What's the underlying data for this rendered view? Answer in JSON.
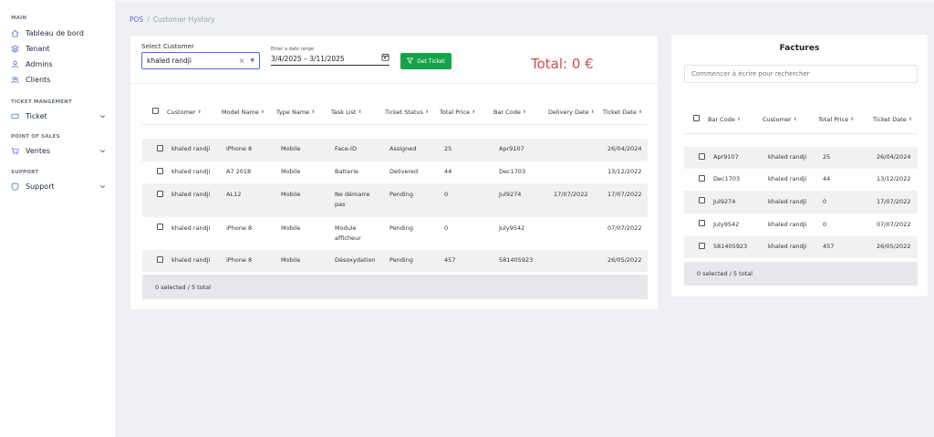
{
  "sidebar": {
    "sections": [
      {
        "title": "MAIN"
      },
      {
        "title": "TICKET MANGEMENT"
      },
      {
        "title": "POINT OF SALES"
      },
      {
        "title": "SUPPORT"
      }
    ],
    "items": [
      {
        "label": "Tableau de bord",
        "icon": "home-icon"
      },
      {
        "label": "Tenant",
        "icon": "layers-icon"
      },
      {
        "label": "Admins",
        "icon": "user-icon"
      },
      {
        "label": "Clients",
        "icon": "users-icon"
      },
      {
        "label": "Ticket",
        "icon": "ticket-icon"
      },
      {
        "label": "Ventes",
        "icon": "cart-icon"
      },
      {
        "label": "Support",
        "icon": "shield-icon"
      }
    ]
  },
  "breadcrumb": {
    "root": "POS",
    "sep": "/",
    "current": "Customer Hystory"
  },
  "filters": {
    "select_label": "Select Customer",
    "customer_value": "khaled randji",
    "date_label": "Enter a date range",
    "date_value": "3/4/2025 – 3/11/2025",
    "get_button": "Get Ticket",
    "total": "Total: 0 €"
  },
  "tickets": {
    "headers": [
      "Customer",
      "Model Name",
      "Type Name",
      "Task List",
      "Ticket Status",
      "Total Price",
      "Bar Code",
      "Delivery Date",
      "Ticket Date"
    ],
    "rows": [
      {
        "customer": "khaled randji",
        "model": "iPhone 8",
        "type": "Mobile",
        "task": "Face-ID",
        "status": "Assigned",
        "price": "25",
        "barcode": "Apr9107",
        "delivery": "",
        "date": "26/04/2024"
      },
      {
        "customer": "khaled randji",
        "model": "A7 2018",
        "type": "Mobile",
        "task": "Batterie",
        "status": "Delivered",
        "price": "44",
        "barcode": "Dec1703",
        "delivery": "",
        "date": "13/12/2022"
      },
      {
        "customer": "khaled randji",
        "model": "AL12",
        "type": "Mobile",
        "task": "Ne démarre pas",
        "status": "Pending",
        "price": "0",
        "barcode": "Jul9274",
        "delivery": "17/07/2022",
        "date": "17/07/2022"
      },
      {
        "customer": "khaled randji",
        "model": "iPhone 8",
        "type": "Mobile",
        "task": "Module afficheur",
        "status": "Pending",
        "price": "0",
        "barcode": "July9542",
        "delivery": "",
        "date": "07/07/2022"
      },
      {
        "customer": "khaled randji",
        "model": "iPhone 8",
        "type": "Mobile",
        "task": "Désoxydation",
        "status": "Pending",
        "price": "457",
        "barcode": "581405923",
        "delivery": "",
        "date": "26/05/2022"
      }
    ],
    "footer": "0 selected / 5 total"
  },
  "factures": {
    "title": "Factures",
    "search_placeholder": "Commencer à écrire pour rechercher",
    "headers": [
      "Bar Code",
      "Customer",
      "Total Price",
      "Ticket Date"
    ],
    "rows": [
      {
        "barcode": "Apr9107",
        "customer": "khaled randji",
        "price": "25",
        "date": "26/04/2024"
      },
      {
        "barcode": "Dec1703",
        "customer": "khaled randji",
        "price": "44",
        "date": "13/12/2022"
      },
      {
        "barcode": "Jul9274",
        "customer": "khaled randji",
        "price": "0",
        "date": "17/07/2022"
      },
      {
        "barcode": "July9542",
        "customer": "khaled randji",
        "price": "0",
        "date": "07/07/2022"
      },
      {
        "barcode": "581405923",
        "customer": "khaled randji",
        "price": "457",
        "date": "26/05/2022"
      }
    ],
    "footer": "0 selected / 5 total"
  },
  "colors": {
    "accent": "#4f6bd8",
    "success": "#16a34a",
    "total": "#d14c4c"
  }
}
